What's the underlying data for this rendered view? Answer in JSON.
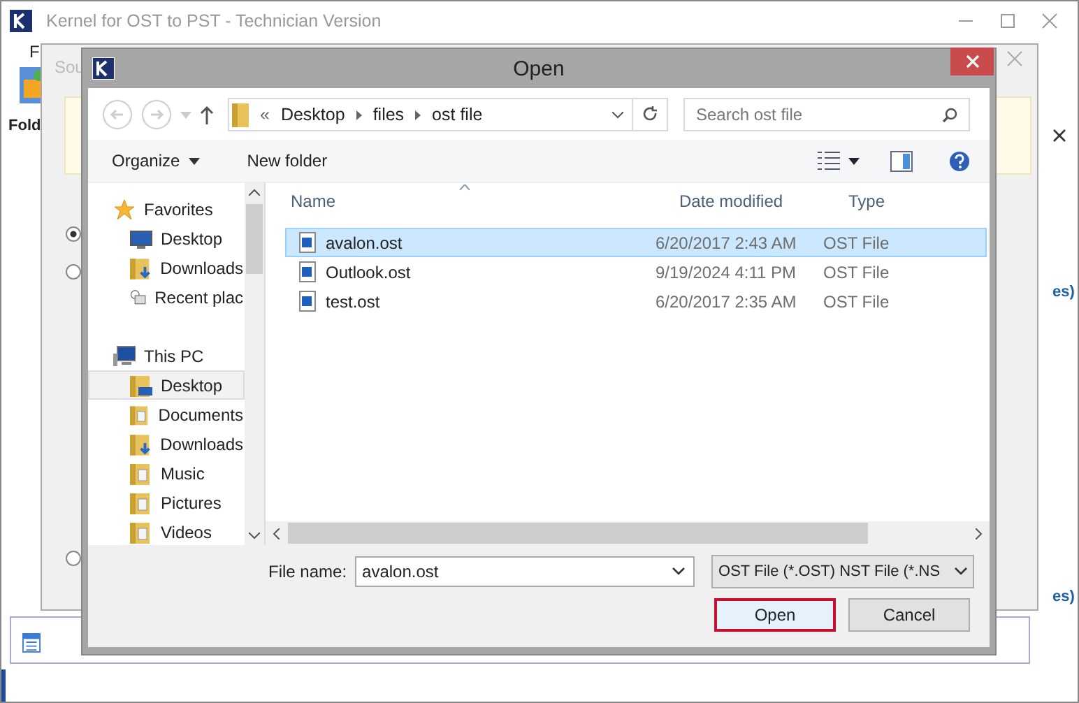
{
  "app": {
    "title": "Kernel for OST to PST - Technician Version",
    "menu_item": "F",
    "panel_label": "Fold",
    "side_links": [
      "es)",
      "es)"
    ]
  },
  "wizard": {
    "title": "Sou",
    "options": [
      {
        "selected": true
      },
      {
        "selected": false
      },
      {
        "selected": false
      }
    ]
  },
  "dialog": {
    "title": "Open",
    "path_prefix": "«",
    "path": [
      "Desktop",
      "files",
      "ost file"
    ],
    "search": {
      "placeholder": "Search ost file"
    },
    "toolbar": [
      "Organize",
      "New folder"
    ],
    "nav": [
      {
        "label": "Favorites",
        "kind": "favorites",
        "children": [
          {
            "label": "Desktop",
            "kind": "desktop",
            "selected": false
          },
          {
            "label": "Downloads",
            "kind": "downloads",
            "selected": false
          },
          {
            "label": "Recent plac",
            "kind": "recent",
            "selected": false
          }
        ]
      },
      {
        "label": "This PC",
        "kind": "pc",
        "children": [
          {
            "label": "Desktop",
            "kind": "desktop-folder",
            "selected": true
          },
          {
            "label": "Documents",
            "kind": "folder",
            "selected": false
          },
          {
            "label": "Downloads",
            "kind": "downloads",
            "selected": false
          },
          {
            "label": "Music",
            "kind": "folder",
            "selected": false
          },
          {
            "label": "Pictures",
            "kind": "folder",
            "selected": false
          },
          {
            "label": "Videos",
            "kind": "folder",
            "selected": false
          }
        ]
      }
    ],
    "columns": [
      "Name",
      "Date modified",
      "Type"
    ],
    "rows": [
      {
        "name": "avalon.ost",
        "date": "6/20/2017 2:43 AM",
        "type": "OST File",
        "selected": true
      },
      {
        "name": "Outlook.ost",
        "date": "9/19/2024 4:11 PM",
        "type": "OST File",
        "selected": false
      },
      {
        "name": "test.ost",
        "date": "6/20/2017 2:35 AM",
        "type": "OST File",
        "selected": false
      }
    ],
    "file_name_label": "File name:",
    "file_name": "avalon.ost",
    "filter": "OST File (*.OST) NST File (*.NS",
    "buttons": [
      {
        "label": "Open",
        "selected": true
      },
      {
        "label": "Cancel",
        "selected": false
      }
    ]
  }
}
